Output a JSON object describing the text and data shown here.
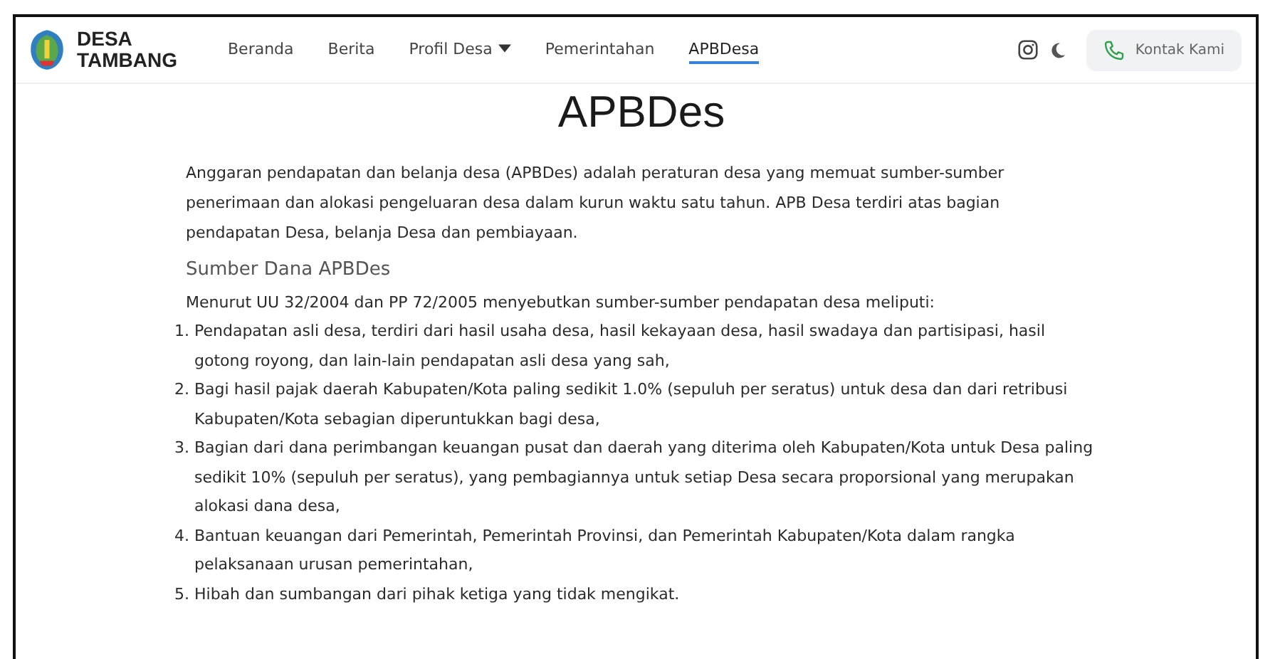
{
  "brand": {
    "line1": "DESA",
    "line2": "TAMBANG"
  },
  "nav": [
    {
      "label": "Beranda",
      "selected": false,
      "dropdown": false
    },
    {
      "label": "Berita",
      "selected": false,
      "dropdown": false
    },
    {
      "label": "Profil Desa",
      "selected": false,
      "dropdown": true
    },
    {
      "label": "Pemerintahan",
      "selected": false,
      "dropdown": false
    },
    {
      "label": "APBDesa",
      "selected": true,
      "dropdown": false
    }
  ],
  "contact_button": "Kontak Kami",
  "title": "APBDes",
  "intro": "Anggaran pendapatan dan belanja desa (APBDes) adalah peraturan desa yang memuat sumber-sumber penerimaan dan alokasi pengeluaran desa dalam kurun waktu satu tahun. APB Desa terdiri atas bagian pendapatan Desa, belanja Desa dan pembiayaan.",
  "section_heading": "Sumber Dana APBDes",
  "section_lead": "Menurut UU 32/2004 dan PP 72/2005 menyebutkan sumber-sumber pendapatan desa meliputi:",
  "list": [
    {
      "number": "1.",
      "text": "Pendapatan asli desa, terdiri dari hasil usaha desa, hasil kekayaan desa, hasil swadaya dan partisipasi, hasil gotong royong, dan lain-lain pendapatan asli desa yang sah,"
    },
    {
      "number": "2.",
      "text": "Bagi hasil pajak daerah Kabupaten/Kota paling sedikit 1.0% (sepuluh per seratus) untuk desa dan dari retribusi Kabupaten/Kota sebagian diperuntukkan bagi desa,"
    },
    {
      "number": "3.",
      "text": "Bagian dari dana perimbangan keuangan pusat dan daerah yang diterima oleh Kabupaten/Kota untuk Desa paling sedikit 10% (sepuluh per seratus), yang pembagiannya untuk setiap Desa secara proporsional yang merupakan alokasi dana desa,"
    },
    {
      "number": "4.",
      "text": "Bantuan keuangan dari Pemerintah, Pemerintah Provinsi, dan Pemerintah Kabupaten/Kota dalam rangka pelaksanaan urusan pemerintahan,"
    },
    {
      "number": "5.",
      "text": "Hibah dan sumbangan dari pihak ketiga yang tidak mengikat."
    }
  ]
}
